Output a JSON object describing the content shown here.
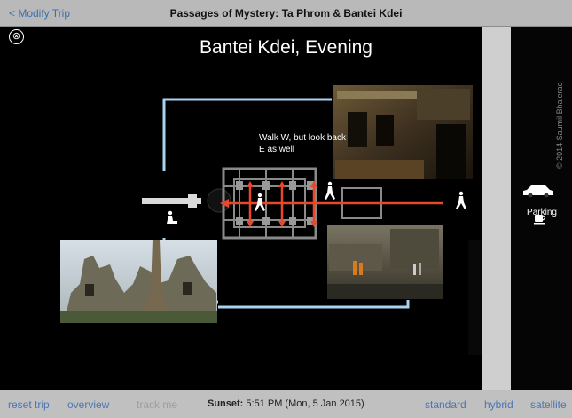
{
  "nav": {
    "back_label": "< Modify Trip",
    "title": "Passages of Mystery: Ta Phrom & Bantei Kdei"
  },
  "view": {
    "title": "Bantei Kdei, Evening",
    "close_glyph": "⊗"
  },
  "map": {
    "caption": "Walk W, but look back E as well",
    "parking_label": "Parking",
    "copyright": "© 2014 Saumil Bhalerao"
  },
  "toolbar": {
    "reset_label": "reset trip",
    "overview_label": "overview",
    "track_label": "track me",
    "sunset_label": "Sunset:",
    "sunset_value": "5:51 PM (Mon, 5 Jan 2015)",
    "standard_label": "standard",
    "hybrid_label": "hybrid",
    "satellite_label": "satellite"
  },
  "colors": {
    "path_blue": "#a9d3ef",
    "arrow_red": "#e8472b",
    "link_blue": "#4a76b3"
  },
  "icons": [
    "close-icon",
    "walker-icon",
    "sitting-person-icon",
    "car-icon",
    "coffee-icon"
  ]
}
